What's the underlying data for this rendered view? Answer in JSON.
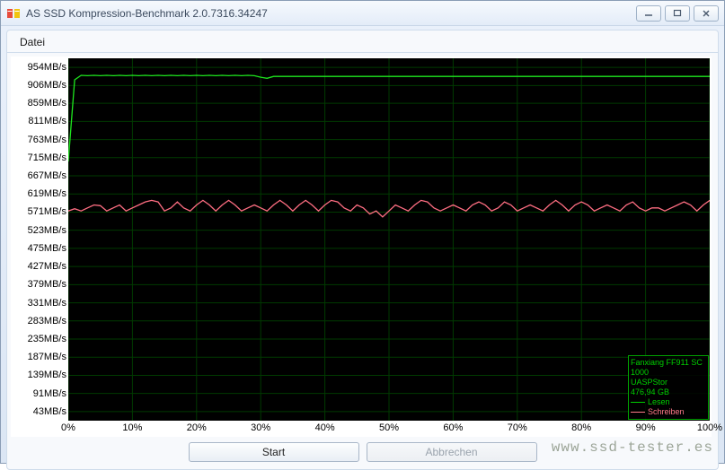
{
  "window": {
    "title": "AS SSD Kompression-Benchmark 2.0.7316.34247"
  },
  "menu": {
    "file": "Datei"
  },
  "buttons": {
    "start": "Start",
    "cancel": "Abbrechen"
  },
  "legend": {
    "device_line1": "Fanxiang FF911 SC",
    "device_line2": "1000",
    "controller": "UASPStor",
    "capacity": "476,94 GB",
    "read": "Lesen",
    "write": "Schreiben"
  },
  "watermark": "www.ssd-tester.es",
  "chart_data": {
    "type": "line",
    "xlabel": "",
    "ylabel": "",
    "x_unit": "%",
    "y_unit": "MB/s",
    "xlim": [
      0,
      100
    ],
    "ylim": [
      19,
      978
    ],
    "y_ticks": [
      43,
      91,
      139,
      187,
      235,
      283,
      331,
      379,
      427,
      475,
      523,
      571,
      619,
      667,
      715,
      763,
      811,
      859,
      906,
      954
    ],
    "x_ticks": [
      0,
      10,
      20,
      30,
      40,
      50,
      60,
      70,
      80,
      90,
      100
    ],
    "x": [
      0,
      1,
      2,
      3,
      4,
      5,
      6,
      7,
      8,
      9,
      10,
      11,
      12,
      13,
      14,
      15,
      16,
      17,
      18,
      19,
      20,
      21,
      22,
      23,
      24,
      25,
      26,
      27,
      28,
      29,
      30,
      31,
      32,
      33,
      34,
      35,
      36,
      37,
      38,
      39,
      40,
      41,
      42,
      43,
      44,
      45,
      46,
      47,
      48,
      49,
      50,
      51,
      52,
      53,
      54,
      55,
      56,
      57,
      58,
      59,
      60,
      61,
      62,
      63,
      64,
      65,
      66,
      67,
      68,
      69,
      70,
      71,
      72,
      73,
      74,
      75,
      76,
      77,
      78,
      79,
      80,
      81,
      82,
      83,
      84,
      85,
      86,
      87,
      88,
      89,
      90,
      91,
      92,
      93,
      94,
      95,
      96,
      97,
      98,
      99,
      100
    ],
    "series": [
      {
        "name": "Lesen",
        "color": "#1ee61e",
        "values": [
          705,
          921,
          933,
          932,
          933,
          932,
          933,
          932,
          933,
          932,
          933,
          932,
          933,
          932,
          933,
          932,
          933,
          932,
          933,
          932,
          933,
          932,
          933,
          932,
          933,
          932,
          933,
          932,
          933,
          932,
          928,
          925,
          930,
          930,
          930,
          930,
          930,
          930,
          930,
          930,
          930,
          930,
          930,
          930,
          930,
          930,
          930,
          930,
          930,
          930,
          930,
          930,
          930,
          930,
          930,
          930,
          930,
          930,
          930,
          930,
          930,
          930,
          930,
          930,
          930,
          930,
          930,
          930,
          930,
          930,
          930,
          930,
          930,
          930,
          930,
          930,
          930,
          930,
          930,
          930,
          930,
          930,
          930,
          930,
          930,
          930,
          930,
          930,
          930,
          930,
          930,
          930,
          930,
          930,
          930,
          930,
          930,
          930,
          930,
          930,
          930
        ]
      },
      {
        "name": "Schreiben",
        "color": "#ff6e82",
        "values": [
          574,
          580,
          574,
          582,
          590,
          588,
          574,
          582,
          590,
          574,
          582,
          590,
          598,
          602,
          598,
          574,
          582,
          598,
          582,
          574,
          590,
          602,
          590,
          574,
          590,
          602,
          590,
          574,
          582,
          590,
          582,
          574,
          590,
          602,
          590,
          574,
          590,
          602,
          590,
          574,
          590,
          602,
          598,
          582,
          574,
          590,
          582,
          566,
          574,
          558,
          574,
          590,
          582,
          574,
          590,
          602,
          598,
          582,
          574,
          582,
          590,
          582,
          574,
          590,
          598,
          590,
          574,
          582,
          598,
          590,
          574,
          582,
          590,
          582,
          574,
          590,
          602,
          590,
          574,
          590,
          598,
          590,
          574,
          582,
          590,
          582,
          574,
          590,
          598,
          582,
          574,
          582,
          582,
          574,
          582,
          590,
          598,
          590,
          574,
          590,
          602
        ]
      }
    ]
  }
}
